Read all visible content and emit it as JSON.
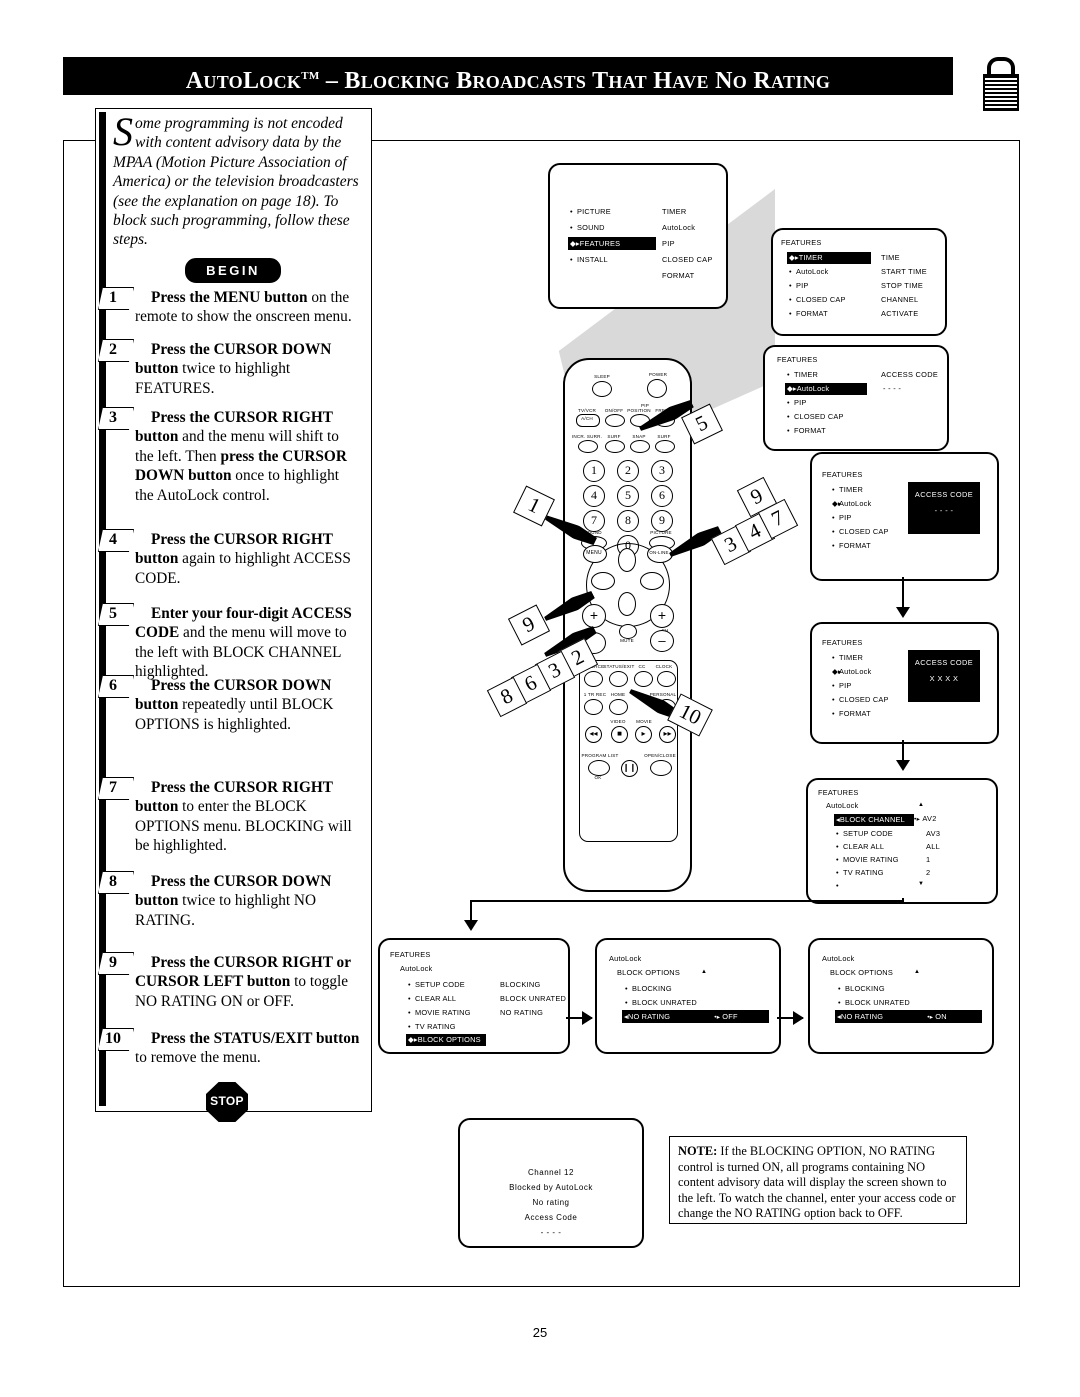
{
  "header": {
    "title_parts": [
      "A",
      "UTO",
      "L",
      "OCK",
      "TM",
      " – ",
      "B",
      "LOCKING",
      " ",
      "B",
      "ROADCASTS",
      " ",
      "T",
      "HAT",
      " ",
      "H",
      "AVE",
      " ",
      "N",
      "O",
      " ",
      "R",
      "ATING"
    ],
    "title_text": "AUTOLOCK™ – BLOCKING BROADCASTS THAT HAVE NO RATING",
    "lock_icon": "open-padlock-icon"
  },
  "intro": {
    "dropcap": "S",
    "text": "ome programming is not encoded with content advisory data by the MPAA (Motion Picture Association of America) or the television broadcasters (see the explanation on page 18). To block such programming, follow these steps.",
    "begin_label": "BEGIN",
    "stop_label": "STOP"
  },
  "steps": [
    {
      "n": "1",
      "html": "<b>Press the MENU button</b> on the remote to show the onscreen menu."
    },
    {
      "n": "2",
      "html": "<b>Press the CURSOR DOWN button</b> twice to highlight FEATURES."
    },
    {
      "n": "3",
      "html": "<b>Press the CURSOR RIGHT button</b> and the menu will shift to the left. Then <b>press the CURSOR DOWN button</b> once to highlight the AutoLock control."
    },
    {
      "n": "4",
      "html": "<b>Press the CURSOR RIGHT button</b> again to highlight ACCESS CODE."
    },
    {
      "n": "5",
      "html": "<b>Enter your four-digit ACCESS CODE</b> and the menu will move to the left with BLOCK CHANNEL highlighted."
    },
    {
      "n": "6",
      "html": "<b>Press the CURSOR DOWN button</b> repeatedly until BLOCK OPTIONS is highlighted."
    },
    {
      "n": "7",
      "html": "<b>Press the CURSOR RIGHT button</b> to enter the BLOCK OPTIONS menu. BLOCKING will be highlighted."
    },
    {
      "n": "8",
      "html": "<b>Press the CURSOR DOWN button</b> twice to highlight NO RATING."
    },
    {
      "n": "9",
      "html": "<b>Press the CURSOR RIGHT or CURSOR LEFT button</b> to toggle NO RATING ON or OFF."
    },
    {
      "n": "10",
      "html": "<b>Press the STATUS/EXIT button</b> to remove the menu."
    }
  ],
  "screens": {
    "s1": {
      "left_items": [
        "PICTURE",
        "SOUND",
        "FEATURES",
        "INSTALL"
      ],
      "highlight": "FEATURES",
      "right_items": [
        "TIMER",
        "AutoLock",
        "PIP",
        "CLOSED CAP",
        "FORMAT"
      ]
    },
    "s2": {
      "header": "FEATURES",
      "left_items": [
        "TIMER",
        "AutoLock",
        "PIP",
        "CLOSED CAP",
        "FORMAT"
      ],
      "highlight": "TIMER",
      "right_items": [
        "TIME",
        "START TIME",
        "STOP TIME",
        "CHANNEL",
        "ACTIVATE"
      ]
    },
    "s3": {
      "header": "FEATURES",
      "left_items": [
        "TIMER",
        "AutoLock",
        "PIP",
        "CLOSED CAP",
        "FORMAT"
      ],
      "highlight": "AutoLock",
      "right_label": "ACCESS CODE",
      "right_value": "-  -  -  -"
    },
    "s4": {
      "header": "FEATURES",
      "left_items": [
        "TIMER",
        "AutoLock",
        "PIP",
        "CLOSED CAP",
        "FORMAT"
      ],
      "highlight": "AutoLock",
      "code_title": "ACCESS CODE",
      "code_value": "-  -  -  -"
    },
    "s5": {
      "header": "FEATURES",
      "left_items": [
        "TIMER",
        "AutoLock",
        "PIP",
        "CLOSED CAP",
        "FORMAT"
      ],
      "highlight": "AutoLock",
      "code_title": "ACCESS CODE",
      "code_value": "X  X  X  X"
    },
    "s6": {
      "header": "FEATURES",
      "subheader": "AutoLock",
      "left_items": [
        "BLOCK CHANNEL",
        "SETUP CODE",
        "CLEAR ALL",
        "MOVIE RATING",
        "TV RATING"
      ],
      "highlight": "BLOCK CHANNEL",
      "right_items": [
        "AV2",
        "AV3",
        "ALL",
        "1",
        "2"
      ],
      "up_arrow": "▲",
      "down_arrow": "▼"
    },
    "s7": {
      "header": "FEATURES",
      "subheader": "AutoLock",
      "left_items": [
        "SETUP CODE",
        "CLEAR ALL",
        "MOVIE RATING",
        "TV RATING",
        "BLOCK OPTIONS"
      ],
      "highlight": "BLOCK OPTIONS",
      "right_items": [
        "BLOCKING",
        "BLOCK UNRATED",
        "NO RATING"
      ]
    },
    "s8": {
      "header": "AutoLock",
      "subheader": "BLOCK OPTIONS",
      "left_items": [
        "BLOCKING",
        "BLOCK UNRATED",
        "NO RATING"
      ],
      "highlight": "NO RATING",
      "highlight_value": "OFF",
      "up_arrow": "▲"
    },
    "s9": {
      "header": "AutoLock",
      "subheader": "BLOCK OPTIONS",
      "left_items": [
        "BLOCKING",
        "BLOCK UNRATED",
        "NO RATING"
      ],
      "highlight": "NO RATING",
      "highlight_value": "ON",
      "up_arrow": "▲"
    },
    "blocked": {
      "lines": [
        "Channel  12",
        "Blocked  by  AutoLock",
        "No  rating",
        "Access  Code",
        "-   -   -   -"
      ]
    }
  },
  "note": {
    "label": "NOTE:",
    "text": " If the BLOCKING OPTION, NO RATING control is turned ON, all programs containing NO content advisory data will display the screen shown to the left. To watch the channel, enter your access code or change the NO RATING option back to OFF."
  },
  "remote": {
    "labels": {
      "sleep": "SLEEP",
      "power": "POWER",
      "tvvcr": "TV/VCR",
      "ach": "A/CH",
      "pip": "PIP",
      "onoff": "ON/OFF",
      "position": "POSITION",
      "freeze": "FREEZE",
      "incr_surr": "INCR. SURR.",
      "surf": "SURF",
      "snap": "SNAP",
      "surf2": "SURF",
      "sound": "SOUND",
      "picture": "PICTURE",
      "menu": "MENU",
      "online": "ON-LINE",
      "vol": "VOL",
      "ch": "CH",
      "mute": "MUTE",
      "source": "SOURCE",
      "status_exit": "STATUS/EXIT",
      "cc": "CC",
      "clock": "CLOCK",
      "trrec": "1 TR REC",
      "home": "HOME",
      "personal": "PERSONAL",
      "video": "VIDEO",
      "movie": "MOVIE",
      "program_list": "PROGRAM LIST",
      "ok": "OK",
      "open_close": "OPEN/CLOSE",
      "plus": "+",
      "minus": "–"
    },
    "keypad": [
      "1",
      "2",
      "3",
      "4",
      "5",
      "6",
      "7",
      "8",
      "9",
      "0"
    ]
  },
  "callouts": {
    "keypad_tag": "5",
    "menu_tag": "1",
    "right_tags": [
      "3",
      "4",
      "7",
      "9"
    ],
    "left_tag": "9",
    "down_tags": [
      "2",
      "3",
      "6",
      "8"
    ],
    "exit_tag": "10"
  },
  "page_number": "25"
}
